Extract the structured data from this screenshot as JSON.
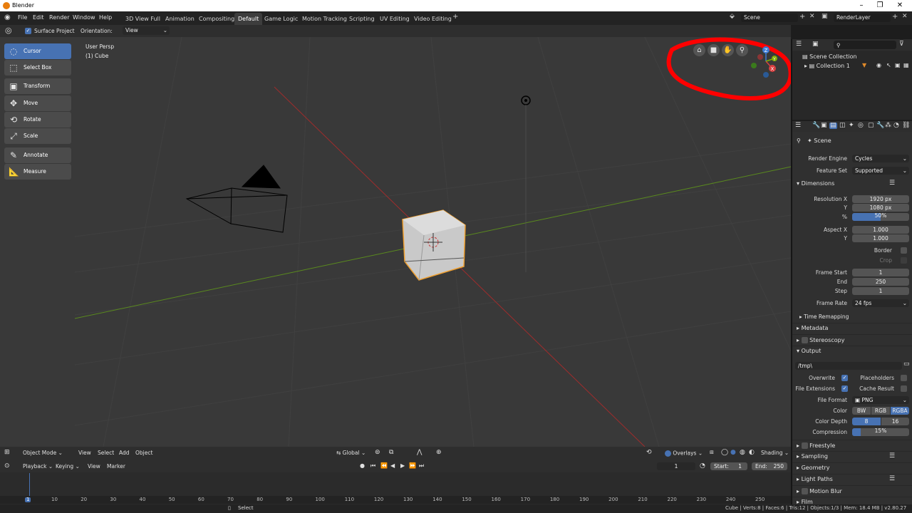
{
  "window": {
    "title": "Blender"
  },
  "menu": [
    "File",
    "Edit",
    "Render",
    "Window",
    "Help"
  ],
  "workspaces": [
    "3D View Full",
    "Animation",
    "Compositing",
    "Default",
    "Game Logic",
    "Motion Tracking",
    "Scripting",
    "UV Editing",
    "Video Editing"
  ],
  "scene": {
    "name": "Scene",
    "render_layer": "RenderLayer"
  },
  "header": {
    "surface_project": "Surface Project",
    "orientation_label": "Orientation:",
    "orientation_value": "View"
  },
  "viewport": {
    "persp": "User Persp",
    "object": "(1) Cube"
  },
  "tools": [
    {
      "label": "Cursor",
      "icon": "cursor-icon"
    },
    {
      "label": "Select Box",
      "icon": "select-box-icon"
    },
    {
      "label": "Transform",
      "icon": "transform-icon"
    },
    {
      "label": "Move",
      "icon": "move-icon"
    },
    {
      "label": "Rotate",
      "icon": "rotate-icon"
    },
    {
      "label": "Scale",
      "icon": "scale-icon"
    },
    {
      "label": "Annotate",
      "icon": "annotate-icon"
    },
    {
      "label": "Measure",
      "icon": "measure-icon"
    }
  ],
  "gizmo": {
    "axis_z": "Z",
    "axis_x": "X",
    "axis_y": "Y"
  },
  "vphead": {
    "mode": "Object Mode",
    "view": "View",
    "select": "Select",
    "add": "Add",
    "object": "Object",
    "transform": "Global",
    "overlays": "Overlays",
    "shading": "Shading"
  },
  "timeline": {
    "playback": "Playback",
    "keying": "Keying",
    "view": "View",
    "marker": "Marker",
    "current_frame": "1",
    "start_label": "Start:",
    "start": "1",
    "end_label": "End:",
    "end": "250",
    "ticks": [
      "1",
      "10",
      "20",
      "30",
      "40",
      "50",
      "60",
      "70",
      "80",
      "90",
      "100",
      "110",
      "120",
      "130",
      "140",
      "150",
      "160",
      "170",
      "180",
      "190",
      "200",
      "210",
      "220",
      "230",
      "240",
      "250"
    ]
  },
  "status": {
    "select": "Select",
    "stats": "Cube | Verts:8 | Faces:6 | Tris:12 | Objects:1/3 | Mem: 18.4 MB | v2.80.27"
  },
  "outliner": {
    "root": "Scene Collection",
    "collection": "Collection 1"
  },
  "props": {
    "scene_label": "Scene",
    "render_engine_label": "Render Engine",
    "render_engine": "Cycles",
    "feature_set_label": "Feature Set",
    "feature_set": "Supported",
    "dimensions": "Dimensions",
    "res_x_label": "Resolution X",
    "res_x": "1920 px",
    "res_y_label": "Y",
    "res_y": "1080 px",
    "res_pct_label": "%",
    "res_pct": "50%",
    "res_pct_value": 0.5,
    "aspect_x_label": "Aspect X",
    "aspect_x": "1.000",
    "aspect_y_label": "Y",
    "aspect_y": "1.000",
    "border": "Border",
    "crop": "Crop",
    "frame_start_label": "Frame Start",
    "frame_start": "1",
    "end_label": "End",
    "end": "250",
    "step_label": "Step",
    "step": "1",
    "frame_rate_label": "Frame Rate",
    "frame_rate": "24 fps",
    "time_remapping": "Time Remapping",
    "metadata": "Metadata",
    "stereoscopy": "Stereoscopy",
    "output": "Output",
    "output_path": "/tmp\\",
    "overwrite": "Overwrite",
    "placeholders": "Placeholders",
    "file_extensions": "File Extensions",
    "cache_result": "Cache Result",
    "file_format_label": "File Format",
    "file_format": "PNG",
    "color_label": "Color",
    "color_bw": "BW",
    "color_rgb": "RGB",
    "color_rgba": "RGBA",
    "color_depth_label": "Color Depth",
    "depth_8": "8",
    "depth_16": "16",
    "compression_label": "Compression",
    "compression": "15%",
    "compression_value": 0.15,
    "freestyle": "Freestyle",
    "sampling": "Sampling",
    "geometry": "Geometry",
    "light_paths": "Light Paths",
    "motion_blur": "Motion Blur",
    "film": "Film"
  }
}
